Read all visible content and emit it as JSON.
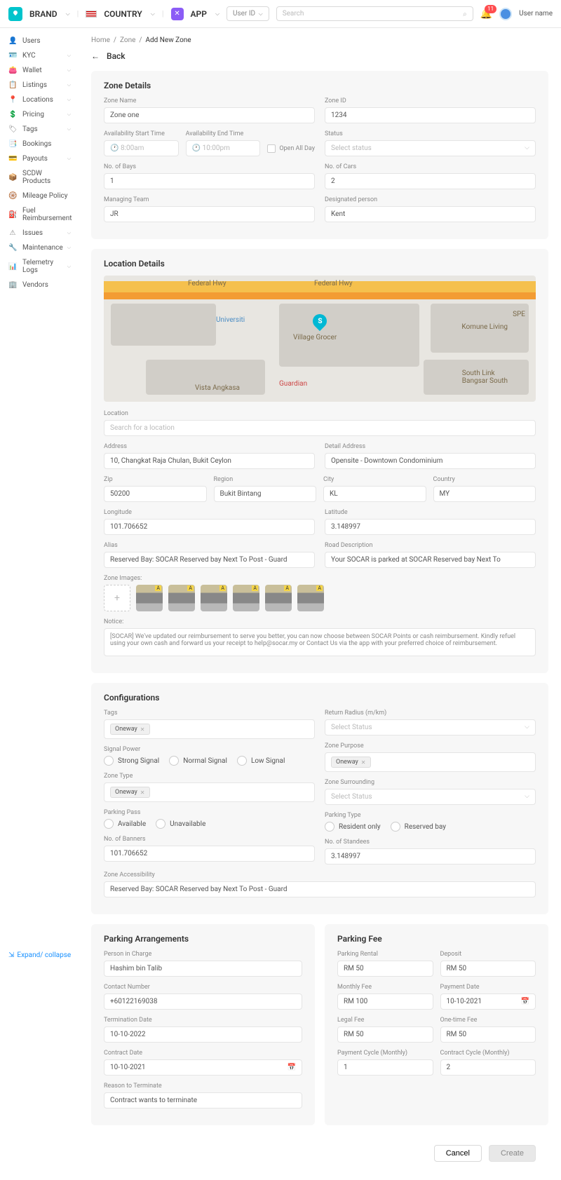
{
  "header": {
    "brand": "BRAND",
    "country": "COUNTRY",
    "app": "APP",
    "user_select": "User ID",
    "search_placeholder": "Search",
    "badge": "11",
    "username": "User name"
  },
  "sidebar": {
    "items": [
      {
        "icon": "👤",
        "label": "Users",
        "expand": false
      },
      {
        "icon": "🪪",
        "label": "KYC",
        "expand": true
      },
      {
        "icon": "👛",
        "label": "Wallet",
        "expand": true
      },
      {
        "icon": "📋",
        "label": "Listings",
        "expand": true
      },
      {
        "icon": "📍",
        "label": "Locations",
        "expand": true
      },
      {
        "icon": "💲",
        "label": "Pricing",
        "expand": true
      },
      {
        "icon": "🏷",
        "label": "Tags",
        "expand": true
      },
      {
        "icon": "📑",
        "label": "Bookings",
        "expand": false
      },
      {
        "icon": "💳",
        "label": "Payouts",
        "expand": true
      },
      {
        "icon": "📦",
        "label": "SCDW Products",
        "expand": false
      },
      {
        "icon": "🛞",
        "label": "Mileage Policy",
        "expand": false
      },
      {
        "icon": "⛽",
        "label": "Fuel Reimbursement",
        "expand": false
      },
      {
        "icon": "⚠",
        "label": "Issues",
        "expand": true
      },
      {
        "icon": "🔧",
        "label": "Maintenance",
        "expand": true
      },
      {
        "icon": "📊",
        "label": "Telemetry Logs",
        "expand": true
      },
      {
        "icon": "🏢",
        "label": "Vendors",
        "expand": false
      }
    ],
    "expand": "Expand/ collapse"
  },
  "crumbs": [
    "Home",
    "Zone",
    "Add New Zone"
  ],
  "back": "Back",
  "zone_details": {
    "title": "Zone Details",
    "zone_name_lbl": "Zone Name",
    "zone_name": "Zone one",
    "zone_id_lbl": "Zone ID",
    "zone_id": "1234",
    "avail_start_lbl": "Availability Start Time",
    "avail_start": "8:00am",
    "avail_end_lbl": "Availability End Time",
    "avail_end": "10:00pm",
    "open_all_day": "Open All Day",
    "status_lbl": "Status",
    "status": "Select status",
    "bays_lbl": "No. of Bays",
    "bays": "1",
    "cars_lbl": "No. of Cars",
    "cars": "2",
    "team_lbl": "Managing Team",
    "team": "JR",
    "person_lbl": "Designated person",
    "person": "Kent"
  },
  "location_details": {
    "title": "Location Details",
    "map_labels": {
      "hwy1": "Federal Hwy",
      "hwy2": "Federal Hwy",
      "uni": "Universiti",
      "village": "Village Grocer",
      "spe": "SPE",
      "komune": "Komune Living",
      "southlink": "South Link\nBangsar South",
      "vista": "Vista Angkasa",
      "guardian": "Guardian"
    },
    "location_lbl": "Location",
    "location_ph": "Search for a location",
    "address_lbl": "Address",
    "address": "10, Changkat Raja Chulan, Bukit Ceylon",
    "detail_lbl": "Detail Address",
    "detail": "Opensite - Downtown Condominium",
    "zip_lbl": "Zip",
    "zip": "50200",
    "region_lbl": "Region",
    "region": "Bukit Bintang",
    "city_lbl": "City",
    "city": "KL",
    "country_lbl": "Country",
    "country": "MY",
    "lng_lbl": "Longitude",
    "lng": "101.706652",
    "lat_lbl": "Latitude",
    "lat": "3.148997",
    "alias_lbl": "Alias",
    "alias": "Reserved Bay: SOCAR Reserved bay Next To Post - Guard",
    "road_lbl": "Road Description",
    "road": "Your SOCAR is parked at SOCAR Reserved bay Next To",
    "images_lbl": "Zone Images:",
    "notice_lbl": "Notice:",
    "notice": "[SOCAR] We've updated our reimbursement to serve you better, you can now choose between SOCAR Points or cash reimbursement. Kindly refuel using your own cash and forward us your receipt to help@socar.my or Contact Us via the app with your preferred choice of reimbursement."
  },
  "config": {
    "title": "Configurations",
    "tags_lbl": "Tags",
    "tags": [
      "Oneway"
    ],
    "return_lbl": "Return Radius (m/km)",
    "return_ph": "Select Status",
    "signal_lbl": "Signal Power",
    "signal_opts": [
      "Strong Signal",
      "Normal Signal",
      "Low Signal"
    ],
    "purpose_lbl": "Zone Purpose",
    "purpose": [
      "Oneway"
    ],
    "zonetype_lbl": "Zone Type",
    "zonetype": [
      "Oneway"
    ],
    "surround_lbl": "Zone Surrounding",
    "surround_ph": "Select Status",
    "pass_lbl": "Parking Pass",
    "pass_opts": [
      "Available",
      "Unavailable"
    ],
    "ptype_lbl": "Parking Type",
    "ptype_opts": [
      "Resident only",
      "Reserved bay"
    ],
    "banners_lbl": "No. of Banners",
    "banners": "101.706652",
    "standees_lbl": "No. of Standees",
    "standees": "3.148997",
    "access_lbl": "Zone Accessibility",
    "access": "Reserved Bay: SOCAR Reserved bay Next To Post - Guard"
  },
  "parking_arr": {
    "title": "Parking Arrangements",
    "pic_lbl": "Person in Charge",
    "pic": "Hashim bin Talib",
    "contact_lbl": "Contact Number",
    "contact": "+60122169038",
    "term_lbl": "Termination Date",
    "term": "10-10-2022",
    "contract_lbl": "Contract Date",
    "contract": "10-10-2021",
    "reason_lbl": "Reason to Terminate",
    "reason": "Contract wants to terminate"
  },
  "parking_fee": {
    "title": "Parking Fee",
    "rental_lbl": "Parking Rental",
    "rental": "RM 50",
    "deposit_lbl": "Deposit",
    "deposit": "RM 50",
    "monthly_lbl": "Monthly Fee",
    "monthly": "RM 100",
    "paydate_lbl": "Payment Date",
    "paydate": "10-10-2021",
    "legal_lbl": "Legal Fee",
    "legal": "RM 50",
    "onetime_lbl": "One-time Fee",
    "onetime": "RM 50",
    "paycycle_lbl": "Payment Cycle (Monthly)",
    "paycycle": "1",
    "contractcycle_lbl": "Contract Cycle (Monthly)",
    "contractcycle": "2"
  },
  "footer": {
    "cancel": "Cancel",
    "create": "Create"
  }
}
